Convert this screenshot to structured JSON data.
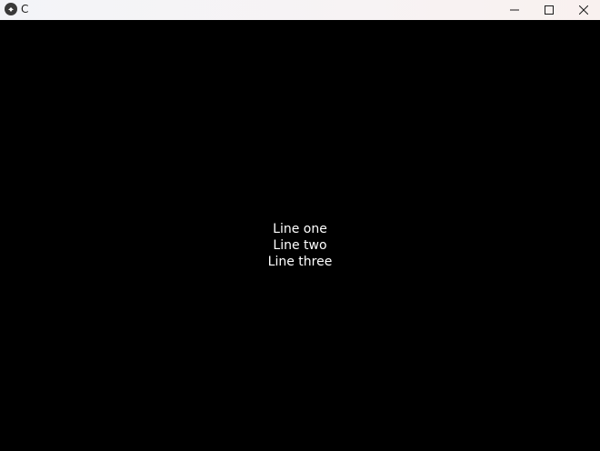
{
  "window": {
    "title": "C",
    "icon": "app-logo-icon",
    "controls": {
      "minimize_icon": "minimize-icon",
      "maximize_icon": "maximize-icon",
      "close_icon": "close-icon"
    }
  },
  "content": {
    "background": "#000000",
    "text_color": "#ffffff",
    "lines": [
      "Line one",
      "Line two",
      "Line three"
    ]
  }
}
